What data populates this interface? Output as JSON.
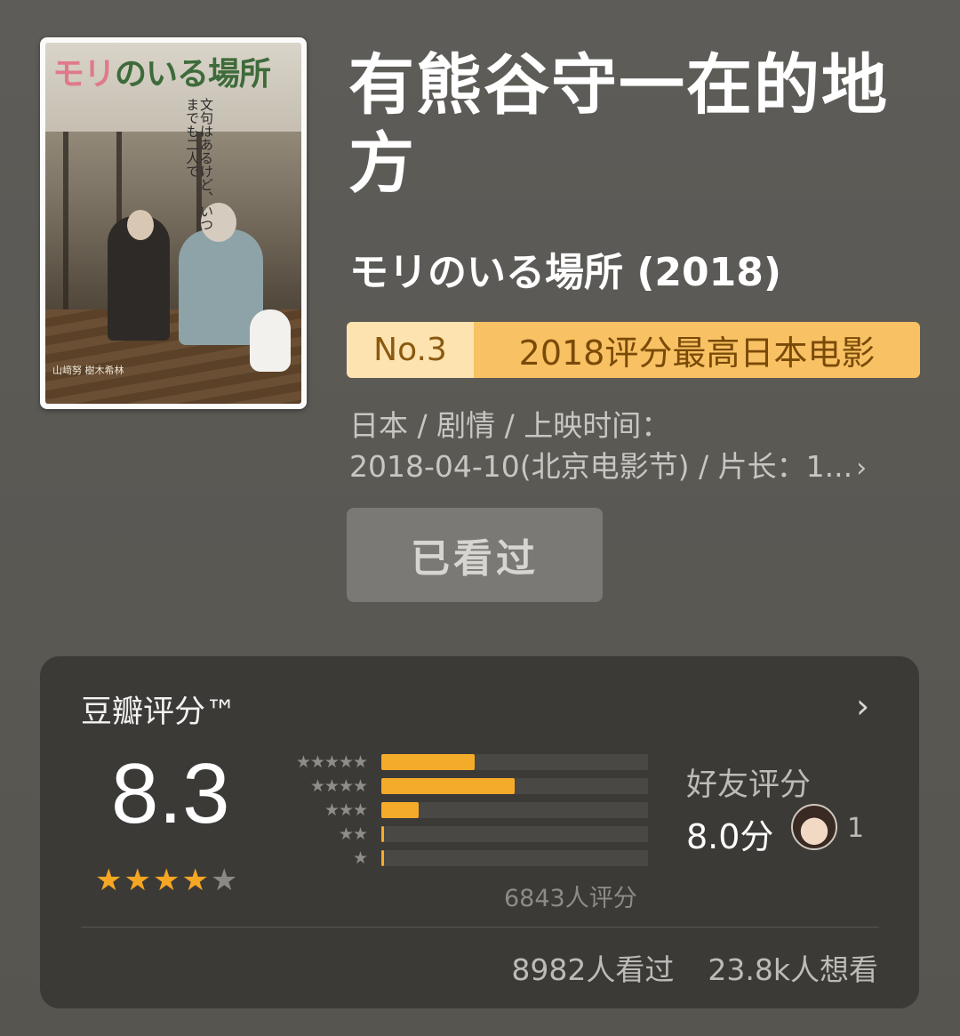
{
  "poster": {
    "title_pink": "モリ",
    "title_rest": "のいる場所",
    "tagline": "文句はあるけど、いつまでも二人で",
    "credits": "山﨑努 樹木希林"
  },
  "movie": {
    "title": "有熊谷守一在的地方",
    "original_title": "モリのいる場所 (2018)",
    "rank_no": "No.3",
    "rank_label": "2018评分最高日本电影",
    "meta_line1": "日本 / 剧情 / 上映时间：",
    "meta_line2": "2018-04-10(北京电影节) / 片长：1...",
    "meta_arrow": "›",
    "watched_label": "已看过"
  },
  "rating": {
    "title": "豆瓣评分™",
    "arrow": "›",
    "score": "8.3",
    "stars": {
      "filled": 4,
      "total": 5
    },
    "distribution": [
      {
        "stars": "★★★★★",
        "fraction": 0.35
      },
      {
        "stars": "★★★★",
        "fraction": 0.5
      },
      {
        "stars": "★★★",
        "fraction": 0.14
      },
      {
        "stars": "★★",
        "fraction": 0.01
      },
      {
        "stars": "★",
        "fraction": 0.01
      }
    ],
    "count": "6843人评分",
    "friend_label": "好友评分",
    "friend_score": "8.0分",
    "friend_count": "1",
    "watched": "8982人看过",
    "wish": "23.8k人想看"
  },
  "colors": {
    "bar_fill": "#f5ab2a",
    "star_on": "#f5a623",
    "badge_bg": "#f8c163"
  }
}
